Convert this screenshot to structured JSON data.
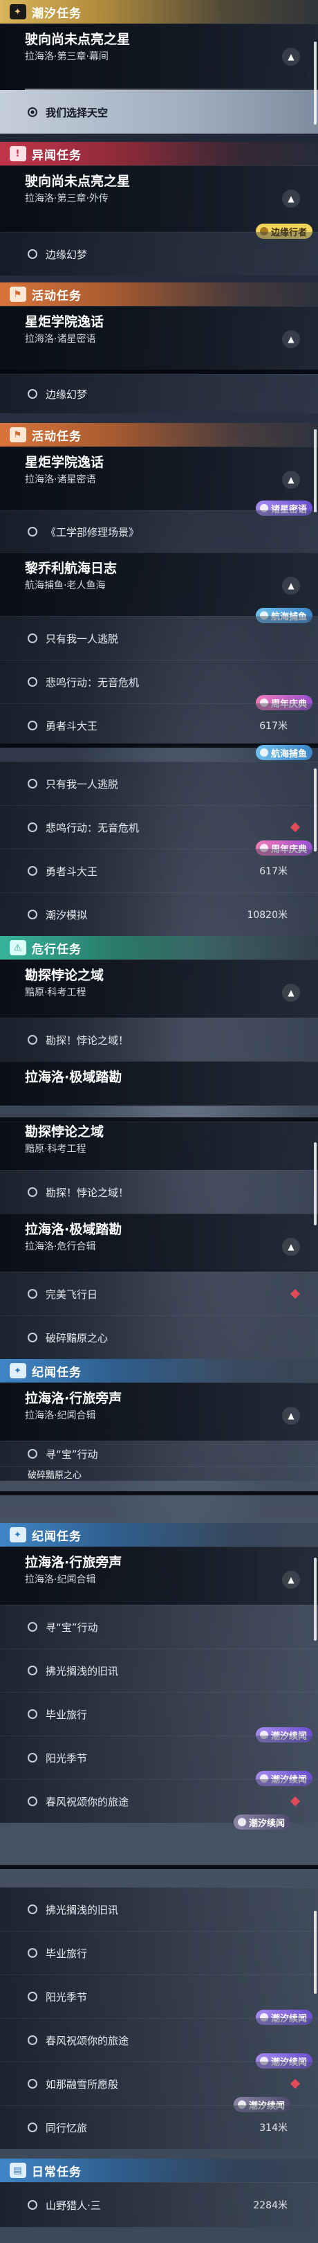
{
  "s1": {
    "cat_trend": "潮汐任务",
    "q1_title": "驶向尚未点亮之星",
    "q1_sub": "拉海洛·第三章·幕间",
    "q1_item": "我们选择天空",
    "cat_other": "异闻任务",
    "q2_title": "驶向尚未点亮之星",
    "q2_sub": "拉海洛·第三章·外传",
    "q2_tag": "边缘行者",
    "q2_item": "边缘幻梦",
    "cat_event": "活动任务",
    "q3_title": "星炬学院逸话",
    "q3_sub": "拉海洛·诸星密语"
  },
  "s2": {
    "item_top": "边缘幻梦",
    "cat_event": "活动任务",
    "q1_title": "星炬学院逸话",
    "q1_sub": "拉海洛·诸星密语",
    "q1_tag": "诸星密语",
    "q1_item": "《工学部修理场景》",
    "q2_title": "黎乔利航海日志",
    "q2_sub": "航海捕鱼·老人鱼海",
    "q2_tag": "航海捕鱼",
    "item_a": "只有我一人逃脱",
    "item_b": "悲鸣行动：无音危机",
    "tag_b": "周年庆典",
    "item_c": "勇者斗大王",
    "dist_c": "617米"
  },
  "s3": {
    "tag_top": "航海捕鱼",
    "item_a": "只有我一人逃脱",
    "item_b": "悲鸣行动：无音危机",
    "tag_b": "周年庆典",
    "item_c": "勇者斗大王",
    "dist_c": "617米",
    "item_d": "潮汐模拟",
    "dist_d": "10820米",
    "cat_danger": "危行任务",
    "q1_title": "勘探悖论之域",
    "q1_sub": "黯原·科考工程",
    "q1_item": "勘探！悖论之域！",
    "q2_title": "拉海洛·极域踏勘"
  },
  "s4": {
    "q1_title": "勘探悖论之域",
    "q1_sub": "黯原·科考工程",
    "q1_item": "勘探！悖论之域！",
    "q2_title": "拉海洛·极域踏勘",
    "q2_sub": "拉海洛·危行合辑",
    "item_a": "完美飞行日",
    "item_b": "破碎黯原之心",
    "cat_record": "纪闻任务",
    "q3_title": "拉海洛·行旅旁声",
    "q3_sub": "拉海洛·纪闻合辑",
    "item_c": "寻“宝”行动",
    "item_d": "破碎黯原之心"
  },
  "s5": {
    "cat_record": "纪闻任务",
    "q1_title": "拉海洛·行旅旁声",
    "q1_sub": "拉海洛·纪闻合辑",
    "items": [
      "寻“宝”行动",
      "拂光搁浅的旧讯",
      "毕业旅行",
      "阳光季节",
      "春风祝颂你的旅途"
    ],
    "tag_d": "潮汐续闻",
    "tag_e": "潮汐续闻",
    "tag_f": "潮汐续闻"
  },
  "s6": {
    "items": [
      "拂光搁浅的旧讯",
      "毕业旅行",
      "阳光季节",
      "春风祝颂你的旅途",
      "如那融雪所愿般",
      "同行忆旅"
    ],
    "tag_c": "潮汐续闻",
    "tag_d": "潮汐续闻",
    "tag_e": "潮汐续闻",
    "dist_f": "314米",
    "cat_daily": "日常任务",
    "daily_item": "山野猎人·三",
    "daily_dist": "2284米"
  }
}
